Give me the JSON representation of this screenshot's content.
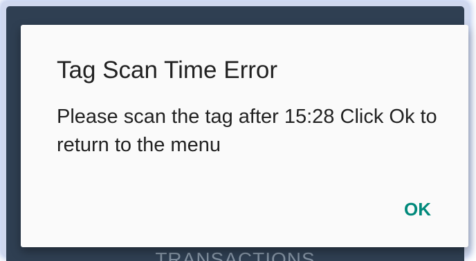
{
  "background": {
    "tab_label": "TRANSACTIONS"
  },
  "dialog": {
    "title": "Tag Scan Time Error",
    "message": "Please scan the tag after 15:28 Click Ok to return to the menu",
    "ok_label": "OK"
  },
  "colors": {
    "accent": "#00897b",
    "app_background": "#2f3f52",
    "dialog_background": "#fafafa",
    "text": "#212121"
  }
}
